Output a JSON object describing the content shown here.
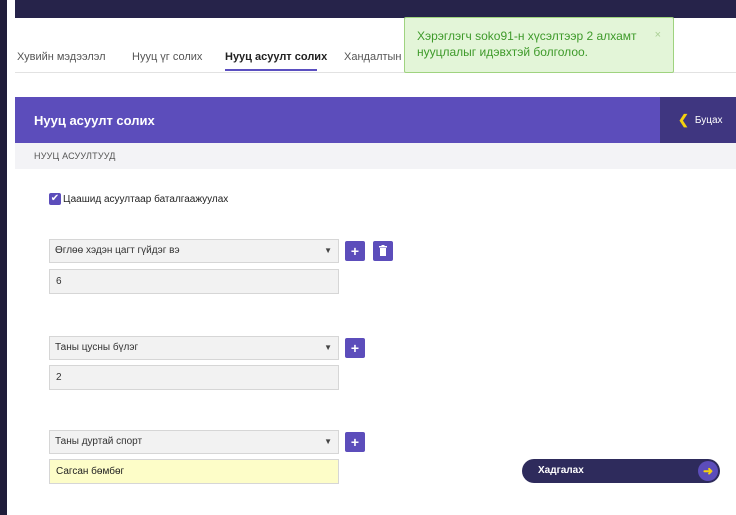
{
  "tabs": [
    {
      "label": "Хувийн мэдээлэл"
    },
    {
      "label": "Нууц үг солих"
    },
    {
      "label": "Нууц асуулт солих"
    },
    {
      "label": "Хандалтын т"
    }
  ],
  "toast": {
    "message": "Хэрэглэгч soko91-н хүсэлтээр 2 алхамт нууцлалыг идэвхтэй болголоо.",
    "close": "×"
  },
  "panel": {
    "title": "Нууц асуулт солих",
    "back_label": "Буцах",
    "subheader": "НУУЦ АСУУЛТУУД"
  },
  "checkbox": {
    "label": "Цаашид асуултаар баталгаажуулах",
    "checked": true
  },
  "questions": [
    {
      "question": "Өглөө хэдэн цагт гүйдэг вэ",
      "answer": "6"
    },
    {
      "question": "Таны цусны бүлэг",
      "answer": "2"
    },
    {
      "question": "Таны дуртай спорт",
      "answer": "Сагсан бөмбөг"
    }
  ],
  "save": {
    "label": "Хадгалах"
  },
  "colors": {
    "accent": "#5c4dbb",
    "dark": "#2e2b5c",
    "arrow": "#f5d10d",
    "toast_bg": "#e3f5d8"
  }
}
